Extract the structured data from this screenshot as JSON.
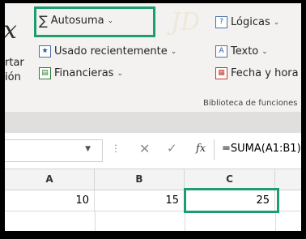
{
  "ribbon": {
    "cut_text": "rtar",
    "cut_text2": "ión",
    "autosum": "Autosuma",
    "recent": "Usado recientemente",
    "financial": "Financieras",
    "logical": "Lógicas",
    "text": "Texto",
    "datetime": "Fecha y hora",
    "group_label": "Biblioteca de funciones",
    "fx_glyph": "fx",
    "watermark": "JD"
  },
  "formula_bar": {
    "fx": "fx",
    "formula": "=SUMA(A1:B1)"
  },
  "grid": {
    "columns": [
      "A",
      "B",
      "C"
    ],
    "row1": [
      "10",
      "15",
      "25"
    ]
  },
  "colors": {
    "highlight": "#1f9d6e",
    "ribbon_bg": "#f3f2f1"
  }
}
